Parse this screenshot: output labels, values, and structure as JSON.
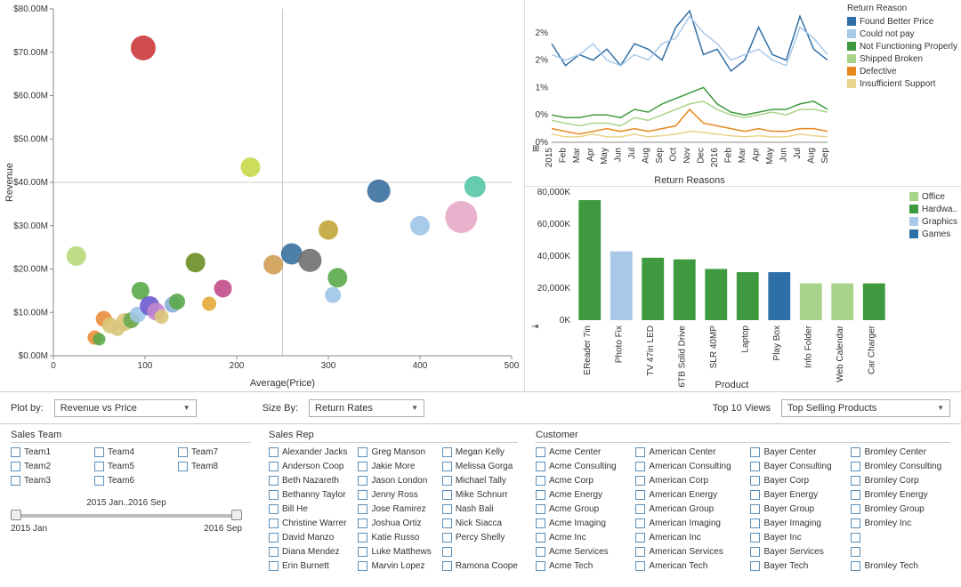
{
  "chart_data": [
    {
      "type": "scatter",
      "title": "",
      "xlabel": "Average(Price)",
      "ylabel": "Revenue",
      "xlim": [
        0,
        500
      ],
      "ylim": [
        0,
        80000000
      ],
      "xticks": [
        0,
        100,
        200,
        300,
        400,
        500
      ],
      "yticks": [
        "$0.00M",
        "$10.00M",
        "$20.00M",
        "$30.00M",
        "$40.00M",
        "$50.00M",
        "$60.00M",
        "$70.00M",
        "$80.00M"
      ],
      "points": [
        {
          "x": 25,
          "y": 23000000,
          "r": 11,
          "c": "#b7d97a"
        },
        {
          "x": 45,
          "y": 4200000,
          "r": 8,
          "c": "#e98e3b"
        },
        {
          "x": 50,
          "y": 3800000,
          "r": 7,
          "c": "#59a848"
        },
        {
          "x": 55,
          "y": 8500000,
          "r": 9,
          "c": "#e98e3b"
        },
        {
          "x": 62,
          "y": 7000000,
          "r": 9,
          "c": "#d9c77a"
        },
        {
          "x": 70,
          "y": 6200000,
          "r": 8,
          "c": "#d9c77a"
        },
        {
          "x": 78,
          "y": 7800000,
          "r": 10,
          "c": "#d9c77a"
        },
        {
          "x": 85,
          "y": 8200000,
          "r": 9,
          "c": "#6aa84f"
        },
        {
          "x": 92,
          "y": 9500000,
          "r": 9,
          "c": "#9fc5e8"
        },
        {
          "x": 95,
          "y": 15000000,
          "r": 10,
          "c": "#59a848"
        },
        {
          "x": 98,
          "y": 71000000,
          "r": 14,
          "c": "#cc3a3a"
        },
        {
          "x": 105,
          "y": 11500000,
          "r": 11,
          "c": "#6a5acd"
        },
        {
          "x": 112,
          "y": 10200000,
          "r": 10,
          "c": "#c285d1"
        },
        {
          "x": 118,
          "y": 9000000,
          "r": 8,
          "c": "#d9c77a"
        },
        {
          "x": 130,
          "y": 11800000,
          "r": 9,
          "c": "#8aaed6"
        },
        {
          "x": 135,
          "y": 12500000,
          "r": 9,
          "c": "#59a848"
        },
        {
          "x": 155,
          "y": 21500000,
          "r": 11,
          "c": "#6b8e23"
        },
        {
          "x": 170,
          "y": 12000000,
          "r": 8,
          "c": "#e4a838"
        },
        {
          "x": 185,
          "y": 15500000,
          "r": 10,
          "c": "#c14c8a"
        },
        {
          "x": 215,
          "y": 43500000,
          "r": 11,
          "c": "#c7d94a"
        },
        {
          "x": 240,
          "y": 21000000,
          "r": 11,
          "c": "#d29f54"
        },
        {
          "x": 260,
          "y": 23500000,
          "r": 12,
          "c": "#3b719f"
        },
        {
          "x": 280,
          "y": 22000000,
          "r": 13,
          "c": "#707070"
        },
        {
          "x": 300,
          "y": 29000000,
          "r": 11,
          "c": "#c2a63a"
        },
        {
          "x": 305,
          "y": 14000000,
          "r": 9,
          "c": "#9fc5e8"
        },
        {
          "x": 310,
          "y": 18000000,
          "r": 11,
          "c": "#59a848"
        },
        {
          "x": 355,
          "y": 38000000,
          "r": 13,
          "c": "#3b719f"
        },
        {
          "x": 400,
          "y": 30000000,
          "r": 11,
          "c": "#9fc5e8"
        },
        {
          "x": 445,
          "y": 32000000,
          "r": 18,
          "c": "#e8a8c8"
        },
        {
          "x": 460,
          "y": 39000000,
          "r": 12,
          "c": "#57c7a6"
        }
      ]
    },
    {
      "type": "line",
      "title": "Return Reasons",
      "xlabel": "",
      "ylabel": "",
      "x": [
        "2015",
        "Feb",
        "Mar",
        "Apr",
        "May",
        "Jun",
        "Jul",
        "Aug",
        "Sep",
        "Oct",
        "Nov",
        "Dec",
        "2016",
        "Feb",
        "Mar",
        "Apr",
        "May",
        "Jun",
        "Jul",
        "Aug",
        "Sep"
      ],
      "yticks": [
        "0%",
        "0%",
        "1%",
        "2%",
        "2%"
      ],
      "series": [
        {
          "name": "Found Better Price",
          "color": "#2f6fa7",
          "values": [
            1.8,
            1.4,
            1.6,
            1.5,
            1.7,
            1.4,
            1.8,
            1.7,
            1.5,
            2.1,
            2.4,
            1.6,
            1.7,
            1.3,
            1.5,
            2.1,
            1.6,
            1.5,
            2.3,
            1.7,
            1.5
          ]
        },
        {
          "name": "Could not pay",
          "color": "#a9c9e8",
          "values": [
            1.6,
            1.5,
            1.6,
            1.8,
            1.5,
            1.4,
            1.6,
            1.5,
            1.8,
            1.9,
            2.3,
            2.0,
            1.8,
            1.5,
            1.6,
            1.7,
            1.5,
            1.4,
            2.1,
            1.9,
            1.6
          ]
        },
        {
          "name": "Not Functioning Properly",
          "color": "#3f9a3f",
          "values": [
            0.5,
            0.45,
            0.45,
            0.5,
            0.5,
            0.45,
            0.6,
            0.55,
            0.7,
            0.8,
            0.9,
            1.0,
            0.7,
            0.55,
            0.5,
            0.55,
            0.6,
            0.6,
            0.7,
            0.75,
            0.6
          ]
        },
        {
          "name": "Shipped Broken",
          "color": "#a7d48a",
          "values": [
            0.4,
            0.35,
            0.3,
            0.35,
            0.35,
            0.3,
            0.45,
            0.4,
            0.5,
            0.6,
            0.7,
            0.75,
            0.6,
            0.5,
            0.45,
            0.5,
            0.55,
            0.5,
            0.6,
            0.6,
            0.55
          ]
        },
        {
          "name": "Defective",
          "color": "#e8871e",
          "values": [
            0.25,
            0.2,
            0.15,
            0.2,
            0.25,
            0.2,
            0.25,
            0.2,
            0.25,
            0.3,
            0.6,
            0.35,
            0.3,
            0.25,
            0.2,
            0.25,
            0.2,
            0.2,
            0.25,
            0.25,
            0.2
          ]
        },
        {
          "name": "Insufficient Support",
          "color": "#e8d48a",
          "values": [
            0.15,
            0.1,
            0.1,
            0.15,
            0.1,
            0.1,
            0.15,
            0.1,
            0.12,
            0.15,
            0.2,
            0.18,
            0.15,
            0.12,
            0.1,
            0.12,
            0.1,
            0.1,
            0.15,
            0.12,
            0.1
          ]
        }
      ]
    },
    {
      "type": "bar",
      "title": "",
      "xlabel": "Product",
      "ylabel": "",
      "ylim": [
        0,
        80000
      ],
      "yticks": [
        "0K",
        "20,000K",
        "40,000K",
        "60,000K",
        "80,000K"
      ],
      "categories": [
        "EReader 7in",
        "Photo Fix",
        "TV 47in LED",
        "6TB Solid Drive",
        "SLR 40MP",
        "Laptop",
        "Play Box",
        "Info Folder",
        "Web Calendar",
        "Car Charger"
      ],
      "values": [
        75000,
        43000,
        39000,
        38000,
        32000,
        30000,
        30000,
        23000,
        23000,
        23000
      ],
      "colors": [
        "#3f9a3f",
        "#a9c9e8",
        "#3f9a3f",
        "#3f9a3f",
        "#3f9a3f",
        "#3f9a3f",
        "#2f6fa7",
        "#a7d48a",
        "#a7d48a",
        "#3f9a3f"
      ],
      "legend": [
        {
          "name": "Office",
          "color": "#a7d48a"
        },
        {
          "name": "Hardwa..",
          "color": "#3f9a3f"
        },
        {
          "name": "Graphics",
          "color": "#a9c9e8"
        },
        {
          "name": "Games",
          "color": "#2f6fa7"
        }
      ]
    }
  ],
  "controls": {
    "plot_by_label": "Plot by:",
    "plot_by_value": "Revenue vs Price",
    "size_by_label": "Size By:",
    "size_by_value": "Return Rates",
    "top10_label": "Top 10 Views",
    "top10_value": "Top Selling Products"
  },
  "filters": {
    "sales_team": {
      "title": "Sales Team",
      "items": [
        "Team1",
        "Team2",
        "Team3",
        "Team4",
        "Team5",
        "Team6",
        "Team7",
        "Team8"
      ]
    },
    "sales_rep": {
      "title": "Sales Rep",
      "items": [
        "Alexander Jacks",
        "Anderson Coop",
        "Beth Nazareth",
        "Bethanny Taylor",
        "Bill He",
        "Christine Warrer",
        "David Manzo",
        "Diana Mendez",
        "Erin Burnett",
        "Greg Manson",
        "Jakie More",
        "Jason London",
        "Jenny Ross",
        "Jose Ramirez",
        "Joshua Ortiz",
        "Katie Russo",
        "Luke Matthews",
        "Marvin Lopez",
        "Megan Kelly",
        "Melissa Gorga",
        "Michael Tally",
        "Mike Schnurr",
        "Nash Bali",
        "Nick Siacca",
        "Percy Shelly",
        "",
        "Ramona Coope"
      ]
    },
    "customer": {
      "title": "Customer",
      "items": [
        "Acme Center",
        "Acme Consulting",
        "Acme Corp",
        "Acme Energy",
        "Acme Group",
        "Acme Imaging",
        "Acme Inc",
        "Acme Services",
        "Acme Tech",
        "American Center",
        "American Consulting",
        "American Corp",
        "American Energy",
        "American Group",
        "American Imaging",
        "American Inc",
        "American Services",
        "American Tech",
        "Bayer Center",
        "Bayer Consulting",
        "Bayer Corp",
        "Bayer Energy",
        "Bayer Group",
        "Bayer Imaging",
        "Bayer Inc",
        "Bayer Services",
        "Bayer Tech",
        "Bromley Center",
        "Bromley Consulting",
        "Bromley Corp",
        "Bromley Energy",
        "Bromley Group",
        "Bromley Inc",
        "",
        "",
        "Bromley Tech"
      ]
    }
  },
  "slider": {
    "range_text": "2015 Jan..2016 Sep",
    "start": "2015 Jan",
    "end": "2016 Sep"
  },
  "legend_title_line": "Return Reason"
}
